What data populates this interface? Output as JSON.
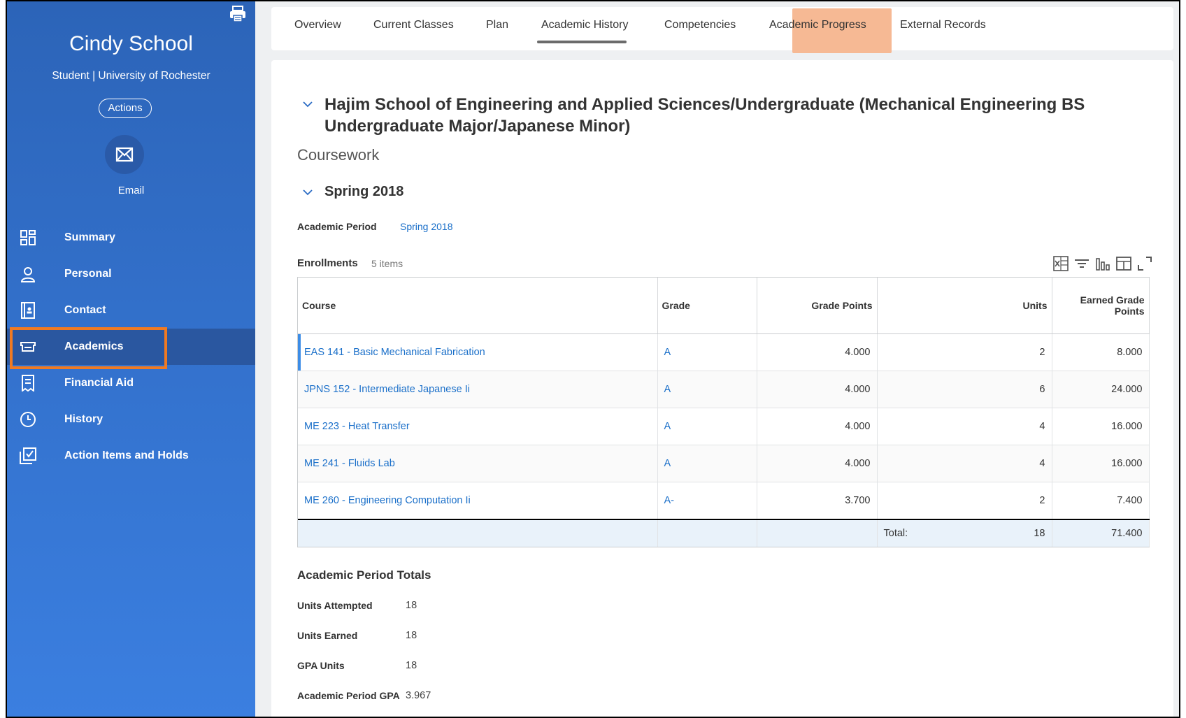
{
  "sidebar": {
    "name": "Cindy School",
    "role": "Student | University of Rochester",
    "actions_label": "Actions",
    "email_label": "Email",
    "items": [
      {
        "label": "Summary",
        "icon": "dashboard-icon"
      },
      {
        "label": "Personal",
        "icon": "person-icon"
      },
      {
        "label": "Contact",
        "icon": "contact-card-icon"
      },
      {
        "label": "Academics",
        "icon": "academics-icon",
        "active": true
      },
      {
        "label": "Financial Aid",
        "icon": "receipt-icon"
      },
      {
        "label": "History",
        "icon": "clock-icon"
      },
      {
        "label": "Action Items and Holds",
        "icon": "checklist-icon"
      }
    ]
  },
  "tabs": [
    {
      "label": "Overview"
    },
    {
      "label": "Current Classes"
    },
    {
      "label": "Plan"
    },
    {
      "label": "Academic History",
      "active": true
    },
    {
      "label": "Competencies"
    },
    {
      "label": "Academic Progress"
    },
    {
      "label": "External Records"
    }
  ],
  "main": {
    "program_title": "Hajim School of Engineering and Applied Sciences/Undergraduate (Mechanical Engineering BS Undergraduate Major/Japanese Minor)",
    "coursework_label": "Coursework",
    "term_title": "Spring 2018",
    "academic_period_label": "Academic Period",
    "academic_period_value": "Spring 2018",
    "enrollments_label": "Enrollments",
    "enrollments_count": "5 items",
    "columns": {
      "course": "Course",
      "grade": "Grade",
      "grade_points": "Grade Points",
      "units": "Units",
      "earned_grade_points": "Earned Grade Points"
    },
    "rows": [
      {
        "course": "EAS 141 - Basic Mechanical Fabrication",
        "grade": "A",
        "grade_points": "4.000",
        "units": "2",
        "earned": "8.000"
      },
      {
        "course": "JPNS 152 - Intermediate Japanese Ii",
        "grade": "A",
        "grade_points": "4.000",
        "units": "6",
        "earned": "24.000"
      },
      {
        "course": "ME 223 - Heat Transfer",
        "grade": "A",
        "grade_points": "4.000",
        "units": "4",
        "earned": "16.000"
      },
      {
        "course": "ME 241 - Fluids Lab",
        "grade": "A",
        "grade_points": "4.000",
        "units": "4",
        "earned": "16.000"
      },
      {
        "course": "ME 260 - Engineering Computation Ii",
        "grade": "A-",
        "grade_points": "3.700",
        "units": "2",
        "earned": "7.400"
      }
    ],
    "total": {
      "label": "Total:",
      "units": "18",
      "earned": "71.400"
    },
    "period_totals_title": "Academic Period Totals",
    "period_totals": [
      {
        "label": "Units Attempted",
        "value": "18"
      },
      {
        "label": "Units Earned",
        "value": "18"
      },
      {
        "label": "GPA Units",
        "value": "18"
      },
      {
        "label": "Academic Period GPA",
        "value": "3.967"
      }
    ]
  },
  "colors": {
    "sidebar_blue": "#3473cf",
    "link_blue": "#1a6fc9",
    "highlight_orange": "#f07a22",
    "tab_active_bg": "#f6b994"
  }
}
